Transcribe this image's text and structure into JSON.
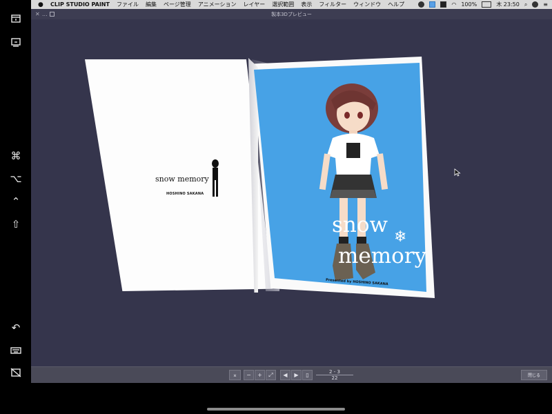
{
  "menubar": {
    "app_name": "CLIP STUDIO PAINT",
    "menus": [
      "ファイル",
      "編集",
      "ページ管理",
      "アニメーション",
      "レイヤー",
      "選択範囲",
      "表示",
      "フィルター",
      "ウィンドウ",
      "ヘルプ"
    ],
    "battery": "100%",
    "clock": "木 23:50"
  },
  "sidebar": {
    "icons": [
      "window-icon",
      "screen-icon",
      "command-key-icon",
      "option-key-icon",
      "control-key-icon",
      "shift-key-icon",
      "undo-icon",
      "keyboard-icon",
      "hide-sidebar-icon"
    ],
    "command_glyph": "⌘",
    "option_glyph": "⌥",
    "control_glyph": "⌃",
    "shift_glyph": "⇧",
    "undo_glyph": "↶"
  },
  "window": {
    "title": "製本3Dプレビュー",
    "close_glyph": "✕",
    "dots": "..."
  },
  "book": {
    "left_title": "snow memory",
    "left_author": "HOSHINO SAKANA",
    "cover_word_1": "snow",
    "cover_word_2": "memory",
    "cover_presented": "Presented by HOSHINO SAKANA",
    "snowflake": "❄"
  },
  "toolbar": {
    "page_spread": "2 - 3",
    "page_total": "22",
    "close_label": "閉じる",
    "prev_glyph": "◀",
    "next_glyph": "▶"
  },
  "colors": {
    "cover_blue": "#47a2e6",
    "window_bg": "#35354c",
    "toolbar_bg": "#4a4a58"
  }
}
